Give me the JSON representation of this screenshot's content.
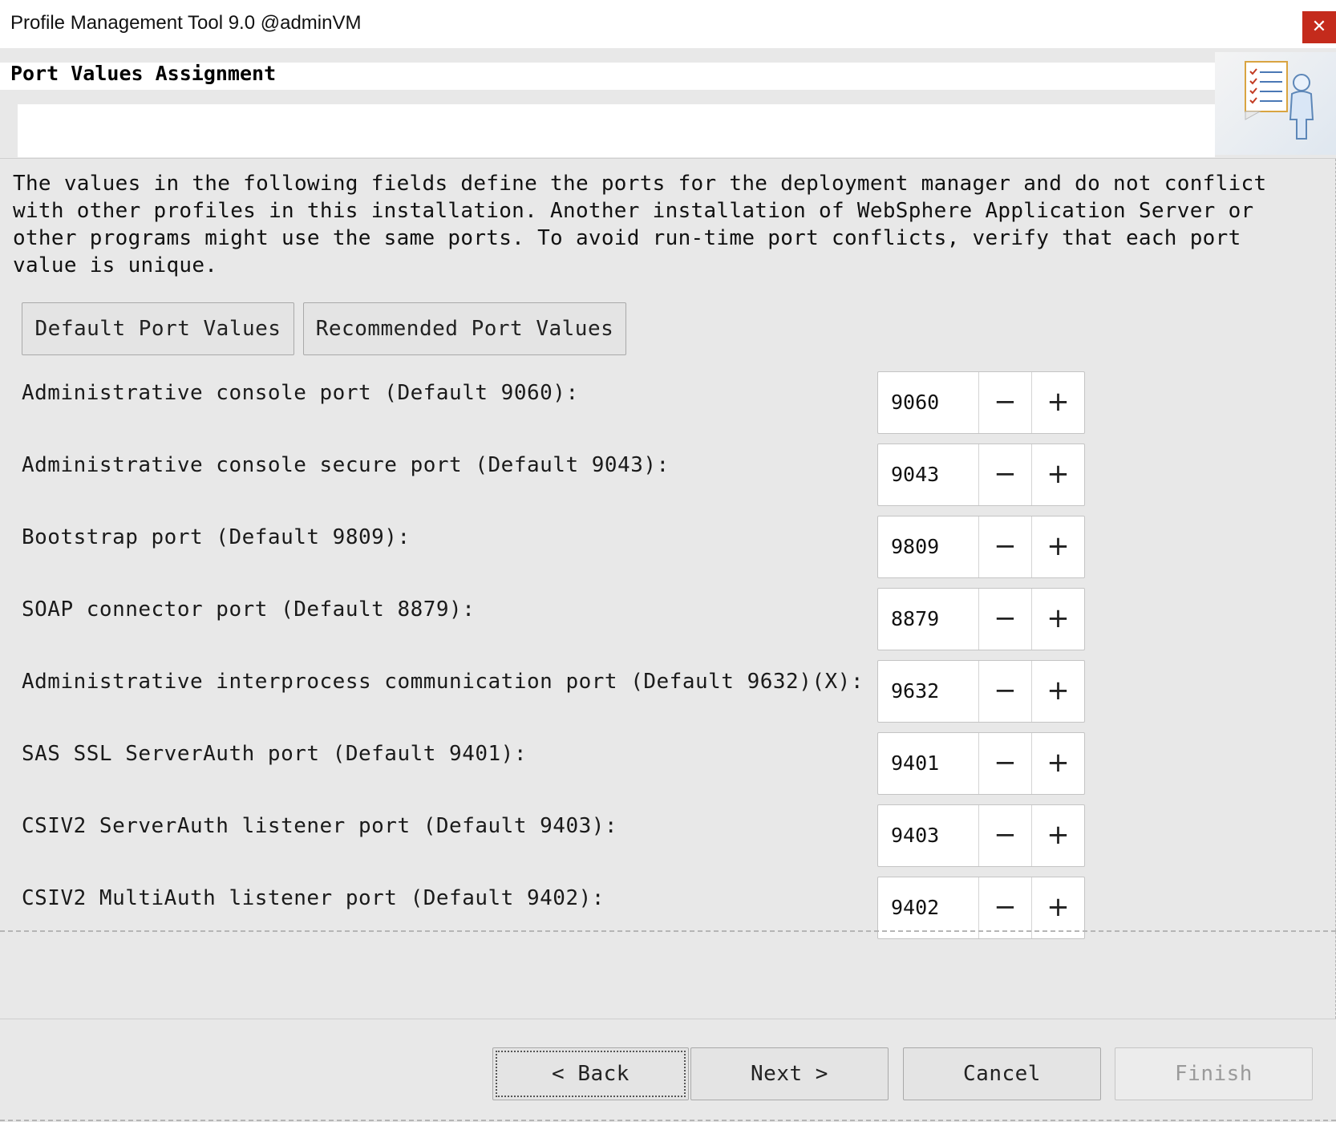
{
  "window": {
    "title": "Profile Management Tool 9.0 @adminVM",
    "close_glyph": "✕"
  },
  "header": {
    "title": "Port Values Assignment",
    "icon": "wizard-checklist-person-icon"
  },
  "intro_text": "The values in the following fields define the ports for the deployment manager and do not conflict\nwith other profiles in this installation. Another installation of WebSphere Application Server or\nother programs might use the same ports. To avoid run-time port conflicts, verify that each port\nvalue is unique.",
  "actions": {
    "default_ports": "Default Port Values",
    "recommended_ports": "Recommended Port Values"
  },
  "ports": [
    {
      "label": "Administrative console port (Default 9060):",
      "value": "9060"
    },
    {
      "label": "Administrative console secure port (Default 9043):",
      "value": "9043"
    },
    {
      "label": "Bootstrap port (Default 9809):",
      "value": "9809"
    },
    {
      "label": "SOAP connector port (Default 8879):",
      "value": "8879"
    },
    {
      "label": "Administrative interprocess communication port (Default 9632)(X):",
      "value": "9632"
    },
    {
      "label": "SAS SSL ServerAuth port (Default 9401):",
      "value": "9401"
    },
    {
      "label": "CSIV2 ServerAuth listener port (Default 9403):",
      "value": "9403"
    },
    {
      "label": "CSIV2 MultiAuth listener port (Default 9402):",
      "value": "9402"
    }
  ],
  "spinner": {
    "minus": "−",
    "plus": "+"
  },
  "footer": {
    "back": "< Back",
    "next": "Next >",
    "cancel": "Cancel",
    "finish": "Finish"
  },
  "colors": {
    "close_button": "#c42b1c",
    "background": "#e8e8e8"
  }
}
